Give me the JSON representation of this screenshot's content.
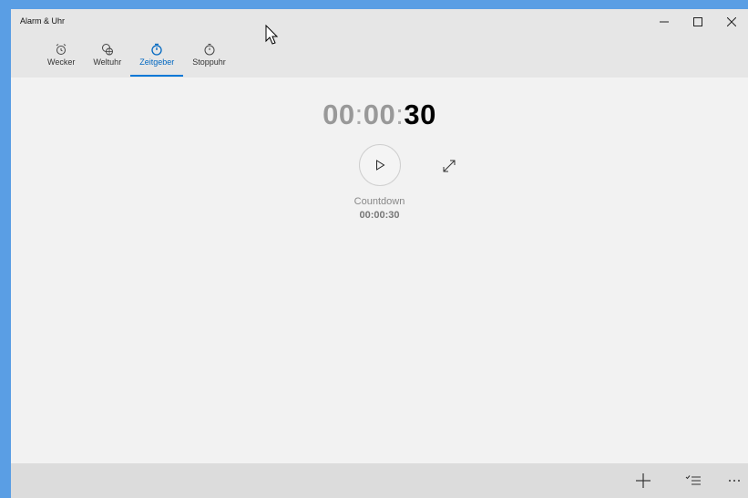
{
  "app": {
    "title": "Alarm & Uhr"
  },
  "tabs": [
    {
      "label": "Wecker",
      "icon": "alarm-clock-icon",
      "active": false
    },
    {
      "label": "Weltuhr",
      "icon": "world-clock-icon",
      "active": false
    },
    {
      "label": "Zeitgeber",
      "icon": "timer-icon",
      "active": true
    },
    {
      "label": "Stoppuhr",
      "icon": "stopwatch-icon",
      "active": false
    }
  ],
  "timer": {
    "hours": "00",
    "minutes": "00",
    "seconds": "30",
    "name": "Countdown",
    "duration": "00:00:30"
  },
  "colors": {
    "accent": "#0078d7",
    "desktop": "#5a9ee4",
    "background": "#f2f2f2",
    "header": "#e6e6e6",
    "bottom_bar": "#dcdcdc"
  }
}
